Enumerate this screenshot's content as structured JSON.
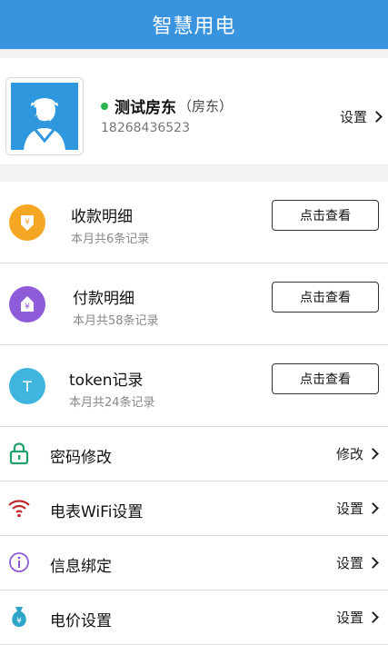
{
  "header": {
    "title": "智慧用电"
  },
  "profile": {
    "name": "测试房东",
    "role": "（房东）",
    "phone": "18268436523",
    "settings_label": "设置",
    "online_color": "#2bb24c"
  },
  "records": [
    {
      "title": "收款明细",
      "subtitle": "本月共6条记录",
      "button": "点击查看",
      "icon": "download-yuan-icon",
      "color": "#f5a623"
    },
    {
      "title": "付款明细",
      "subtitle": "本月共58条记录",
      "button": "点击查看",
      "icon": "upload-yuan-icon",
      "color": "#8e5cd9"
    },
    {
      "title": "token记录",
      "subtitle": "本月共24条记录",
      "icon_text": "T",
      "button": "点击查看",
      "icon": "token-icon",
      "color": "#3fb4de"
    }
  ],
  "settings": [
    {
      "label": "密码修改",
      "action": "修改",
      "icon": "lock-icon",
      "color": "#1f9f6a"
    },
    {
      "label": "电表WiFi设置",
      "action": "设置",
      "icon": "wifi-icon",
      "color": "#c0282d"
    },
    {
      "label": "信息绑定",
      "action": "设置",
      "icon": "info-icon",
      "color": "#8e5cd9"
    },
    {
      "label": "电价设置",
      "action": "设置",
      "icon": "money-bag-icon",
      "color": "#2fa4c9"
    }
  ],
  "colors": {
    "header_bg": "#3a93de",
    "page_bg": "#f2f2f2"
  }
}
